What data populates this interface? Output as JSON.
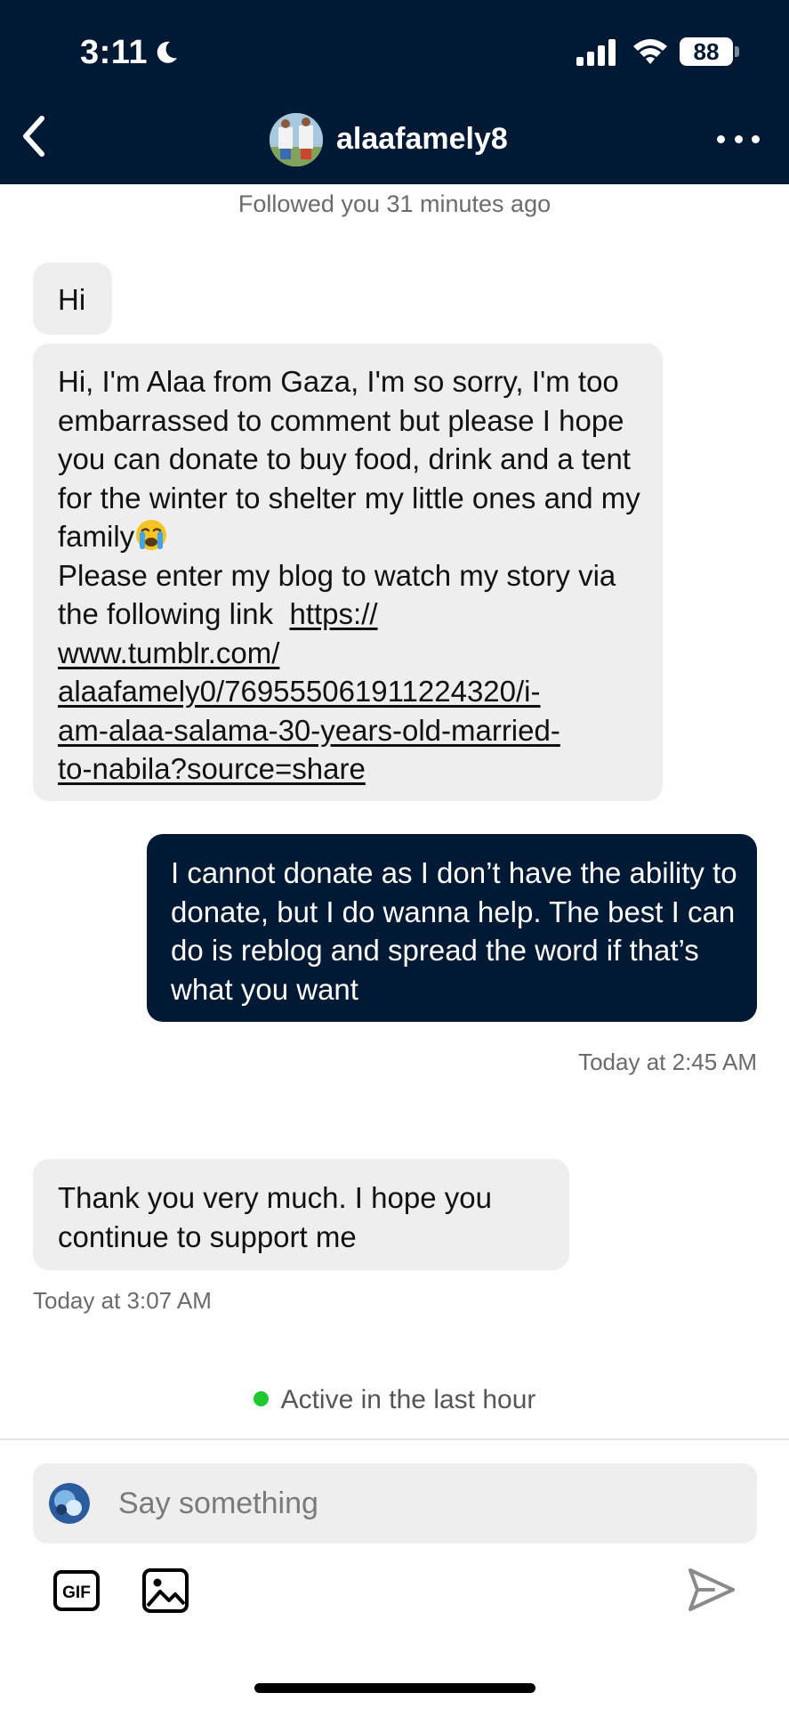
{
  "status_bar": {
    "time": "3:11",
    "battery": "88"
  },
  "header": {
    "username": "alaafamely8"
  },
  "conversation": {
    "followed_note": "Followed you 31 minutes ago",
    "messages": [
      {
        "from": "them",
        "text": "Hi"
      },
      {
        "from": "them",
        "text": "Hi, I'm Alaa from Gaza, I'm so sorry, I'm too embarrassed to comment but please I hope you can donate to buy food, drink and a tent for the winter to shelter my little ones and my  family",
        "emoji": "loudly-crying-face",
        "text2": "Please enter my blog to watch my story via the following link",
        "link_lines": [
          "https://",
          "www.tumblr.com/",
          "alaafamely0/769555061911224320/i-",
          "am-alaa-salama-30-years-old-married-",
          "to-nabila?source=share"
        ]
      },
      {
        "from": "me",
        "text": "I cannot donate as I don’t have the ability to donate, but I do wanna help. The best I can do is reblog and spread the word if that’s what you want",
        "timestamp": "Today at 2:45 AM"
      },
      {
        "from": "them",
        "text": "Thank you very much. I hope you continue to support me",
        "timestamp": "Today at 3:07 AM"
      }
    ],
    "active_status": "Active in the last hour"
  },
  "composer": {
    "placeholder": "Say something",
    "gif_label": "GIF"
  },
  "colors": {
    "header_bg": "#001935",
    "outgoing_bubble": "#001935",
    "incoming_bubble": "#eeeeef",
    "active_dot": "#1ec92f"
  },
  "icons": [
    "moon-icon",
    "signal-icon",
    "wifi-icon",
    "battery-icon",
    "back-arrow-icon",
    "more-icon",
    "gif-icon",
    "image-icon",
    "send-icon"
  ]
}
